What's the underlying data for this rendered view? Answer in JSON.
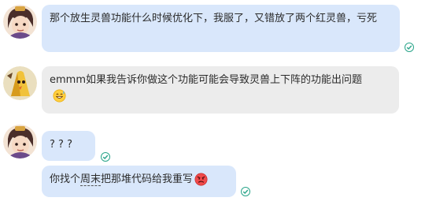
{
  "messages": [
    {
      "sender": "self-avatar",
      "text": "那个放生灵兽功能什么时候优化下，我服了，又错放了两个红灵兽，亏死",
      "read": true
    },
    {
      "sender": "peer-avatar",
      "text": "emmm如果我告诉你做这个功能可能会导致灵兽上下阵的功能出问题",
      "emoji": "sweat-smile-emoji"
    },
    {
      "sender": "self-avatar",
      "text": "? ? ?",
      "read": true
    },
    {
      "sender": "self-avatar",
      "text_before": "你找个",
      "text_underlined": "周末",
      "text_after": "把那堆代码给我重写",
      "emoji": "angry-face-emoji",
      "read": true
    }
  ],
  "colors": {
    "self_bubble": "#d9e7fb",
    "peer_bubble": "#ececec",
    "read_check": "#2aa58a"
  }
}
